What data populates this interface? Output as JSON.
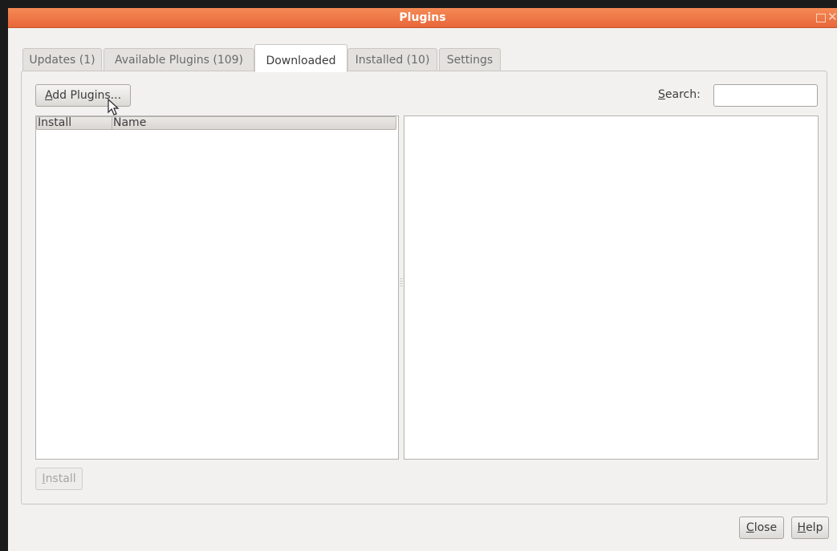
{
  "window": {
    "title": "Plugins",
    "title_bar_color": "#e8673a"
  },
  "tabs": [
    {
      "label": "Updates (1)",
      "active": false
    },
    {
      "label": "Available Plugins (109)",
      "active": false
    },
    {
      "label": "Downloaded",
      "active": true
    },
    {
      "label": "Installed (10)",
      "active": false
    },
    {
      "label": "Settings",
      "active": false
    }
  ],
  "toolbar": {
    "add_plugins_mnemonic": "A",
    "add_plugins_rest": "dd Plugins...",
    "search_mnemonic": "S",
    "search_rest": "earch:",
    "search_value": ""
  },
  "list": {
    "columns": [
      "Install",
      "Name"
    ],
    "rows": []
  },
  "footer": {
    "install_mnemonic": "I",
    "install_rest": "nstall",
    "close_mnemonic": "C",
    "close_rest": "lose",
    "help_mnemonic": "H",
    "help_rest": "elp"
  },
  "icons": [
    "maximize-icon",
    "close-icon",
    "mouse-pointer-icon"
  ]
}
